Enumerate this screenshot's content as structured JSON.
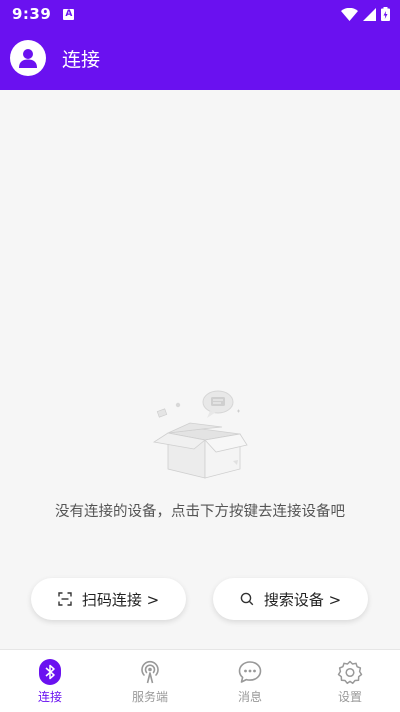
{
  "status_bar": {
    "time": "9:39",
    "notification_icon_letter": "A"
  },
  "app_bar": {
    "title": "连接"
  },
  "empty_state": {
    "message": "没有连接的设备，点击下方按键去连接设备吧"
  },
  "actions": {
    "scan_label": "扫码连接 >",
    "search_label": "搜索设备 >"
  },
  "bottom_nav": {
    "items": [
      {
        "label": "连接",
        "icon": "bluetooth-icon",
        "active": true
      },
      {
        "label": "服务端",
        "icon": "broadcast-icon",
        "active": false
      },
      {
        "label": "消息",
        "icon": "chat-icon",
        "active": false
      },
      {
        "label": "设置",
        "icon": "gear-icon",
        "active": false
      }
    ]
  },
  "colors": {
    "accent": "#6a11f0",
    "background": "#f6f6f6",
    "inactive": "#999999"
  }
}
